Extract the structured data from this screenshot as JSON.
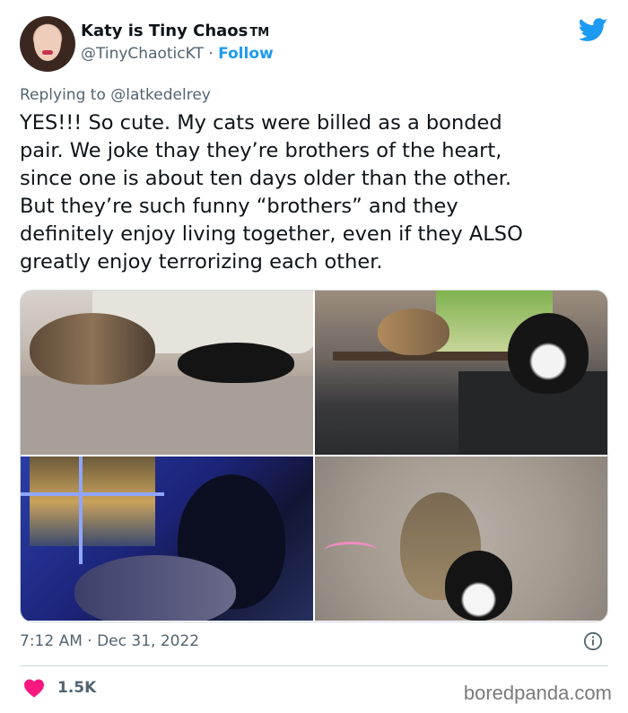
{
  "author": {
    "name": "Katy is Tiny Chaos",
    "name_suffix": "TM",
    "handle": "@TinyChaoticKT",
    "separator": "·",
    "follow_label": "Follow"
  },
  "reply": {
    "prefix": "Replying to",
    "to": "@latkedelrey"
  },
  "tweet": {
    "text": "YES!!! So cute. My cats were billed as a bonded\npair. We joke thay they’re brothers of the heart,\nsince one is about ten days older than the other.\nBut they’re such funny “brothers” and they\ndefinitely enjoy living together, even if they ALSO\ngreatly enjoy terrorizing each other."
  },
  "media": {
    "photos": [
      {
        "label": "photo-cats-on-couch"
      },
      {
        "label": "photo-cats-on-desk"
      },
      {
        "label": "photo-cat-at-window-night"
      },
      {
        "label": "photo-cats-on-carpet"
      }
    ]
  },
  "footer": {
    "time": "7:12 AM · Dec 31, 2022",
    "like_count": "1.5K"
  },
  "watermark": "boredpanda.com",
  "colors": {
    "accent": "#1d9bf0",
    "heart": "#f91880",
    "secondary_text": "#536471"
  },
  "icons": [
    "twitter-bird-icon",
    "info-icon",
    "heart-icon"
  ]
}
